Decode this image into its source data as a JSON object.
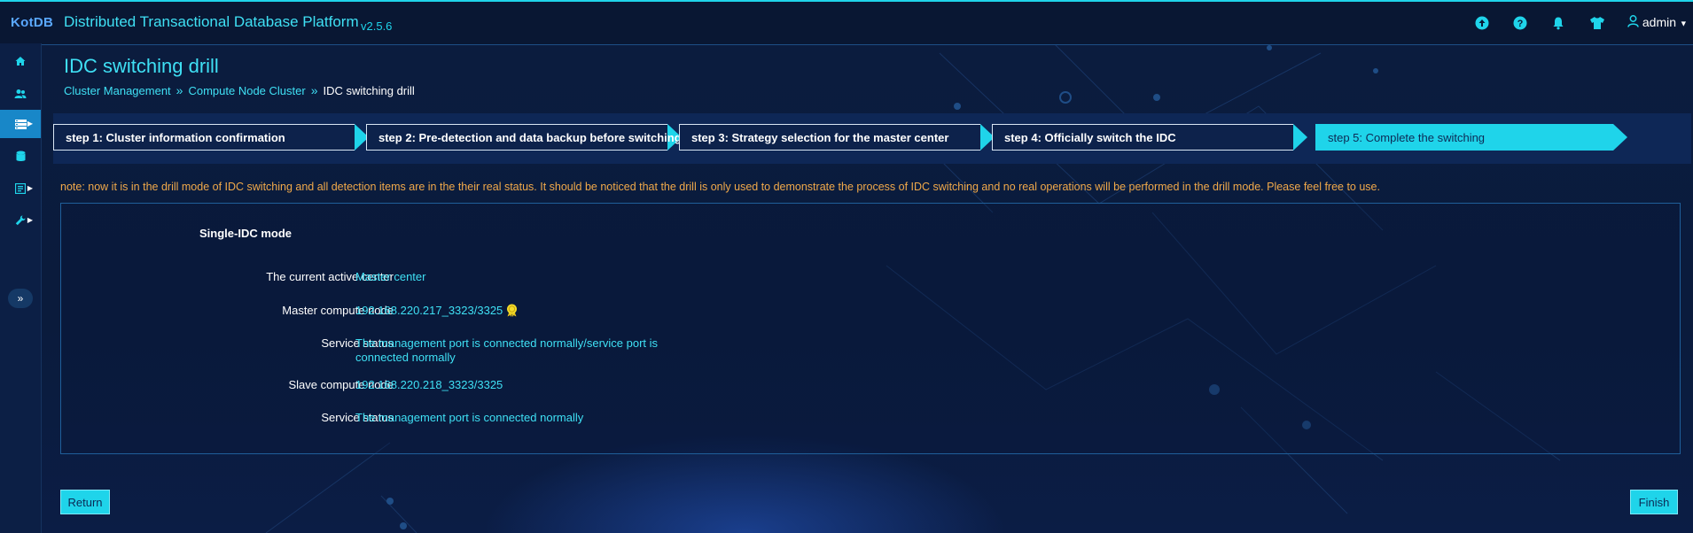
{
  "header": {
    "logo": "KotDB",
    "title": "Distributed Transactional Database Platform",
    "version": "v2.5.6",
    "user": "admin",
    "icons": [
      "upload-icon",
      "help-icon",
      "bell-icon",
      "shirt-icon",
      "user-icon"
    ]
  },
  "sidebar": {
    "items": [
      {
        "icon": "home-icon"
      },
      {
        "icon": "users-icon"
      },
      {
        "icon": "cluster-icon",
        "active": true,
        "has_submenu": true
      },
      {
        "icon": "database-icon"
      },
      {
        "icon": "file-icon",
        "has_submenu": true
      },
      {
        "icon": "wrench-icon",
        "has_submenu": true
      }
    ],
    "collapse_icon": "double-chevron-right-icon"
  },
  "page": {
    "title": "IDC switching drill",
    "breadcrumb": [
      "Cluster Management",
      "Compute Node Cluster",
      "IDC switching drill"
    ],
    "breadcrumb_separator": "»"
  },
  "steps": [
    {
      "label": "step 1: Cluster information confirmation",
      "state": "done"
    },
    {
      "label": "step 2: Pre-detection and data backup before switching",
      "state": "done"
    },
    {
      "label": "step 3: Strategy selection for the master center",
      "state": "done"
    },
    {
      "label": "step 4: Officially switch the IDC",
      "state": "done"
    },
    {
      "label": "step 5: Complete the switching",
      "state": "active"
    }
  ],
  "note": "note: now it is in the drill mode of IDC switching and all detection items are in the their real status. It should be noticed that the drill is only used to demonstrate the process of IDC switching and no real operations will be performed in the drill mode. Please feel free to use.",
  "panel": {
    "mode_title": "Single-IDC mode",
    "rows": [
      {
        "label": "The current active center",
        "value": "Master center"
      },
      {
        "label": "Master compute node",
        "value": "192.168.220.217_3323/3325",
        "badge_icon": "medal-icon"
      },
      {
        "label": "Service status",
        "value": "The management port is connected normally/service port is connected normally"
      },
      {
        "label": "Slave compute node",
        "value": "192.168.220.218_3323/3325"
      },
      {
        "label": "Service status",
        "value": "The management port is connected normally"
      }
    ]
  },
  "buttons": {
    "return": "Return",
    "finish": "Finish"
  },
  "colors": {
    "accent": "#1fd4ea",
    "note": "#f0a94a",
    "background": "#0a1a3a"
  }
}
